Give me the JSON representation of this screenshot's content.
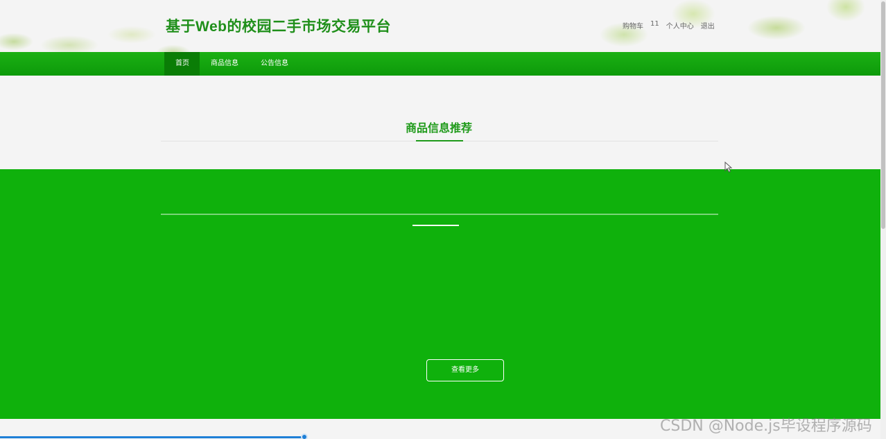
{
  "header": {
    "site_title": "基于Web的校园二手市场交易平台",
    "links": {
      "cart": "购物车",
      "cart_count": "11",
      "profile": "个人中心",
      "logout": "退出"
    }
  },
  "nav": {
    "items": [
      {
        "label": "首页",
        "active": true
      },
      {
        "label": "商品信息",
        "active": false
      },
      {
        "label": "公告信息",
        "active": false
      }
    ]
  },
  "main": {
    "section_title": "商品信息推荐",
    "more_button": "查看更多"
  },
  "playback": {
    "progress": 0.346
  },
  "watermark": "CSDN @Node.js毕设程序源码",
  "colors": {
    "brand_green": "#1f8f1a",
    "nav_green": "#0fa00c",
    "block_green": "#0fb10c",
    "progress_blue": "#1e7fd6"
  }
}
